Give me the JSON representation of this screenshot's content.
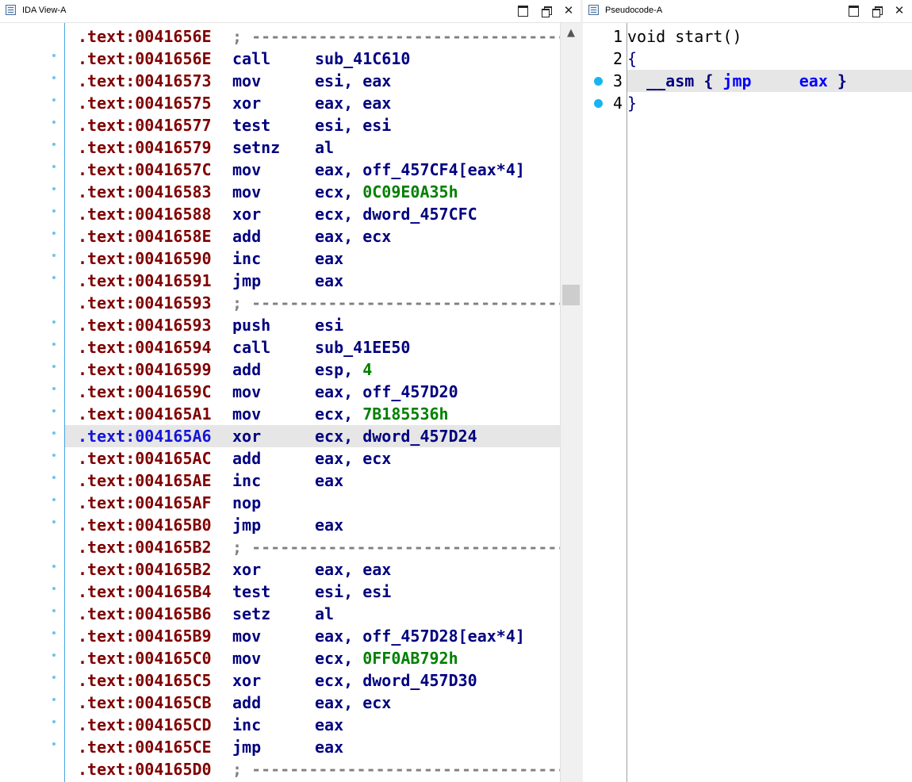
{
  "ida_window": {
    "title": "IDA View-A"
  },
  "pseudo_window": {
    "title": "Pseudocode-A"
  },
  "window_controls": {
    "maximize": "☐",
    "restore": "⧉",
    "close": "✕"
  },
  "ida_listing": [
    {
      "addr": ".text:0041656E",
      "type": "sep",
      "text": "; ---------------------------------------------------------------------------",
      "dot": false
    },
    {
      "addr": ".text:0041656E",
      "mnem": "call",
      "ops": [
        {
          "t": "sub_41C610",
          "k": "n"
        }
      ],
      "dot": true
    },
    {
      "addr": ".text:00416573",
      "mnem": "mov",
      "ops": [
        {
          "t": "esi, eax",
          "k": "n"
        }
      ],
      "dot": true
    },
    {
      "addr": ".text:00416575",
      "mnem": "xor",
      "ops": [
        {
          "t": "eax, eax",
          "k": "n"
        }
      ],
      "dot": true
    },
    {
      "addr": ".text:00416577",
      "mnem": "test",
      "ops": [
        {
          "t": "esi, esi",
          "k": "n"
        }
      ],
      "dot": true
    },
    {
      "addr": ".text:00416579",
      "mnem": "setnz",
      "ops": [
        {
          "t": "al",
          "k": "n"
        }
      ],
      "dot": true
    },
    {
      "addr": ".text:0041657C",
      "mnem": "mov",
      "ops": [
        {
          "t": "eax, off_457CF4[eax*4]",
          "k": "n"
        }
      ],
      "dot": true
    },
    {
      "addr": ".text:00416583",
      "mnem": "mov",
      "ops": [
        {
          "t": "ecx, ",
          "k": "n"
        },
        {
          "t": "0C09E0A35h",
          "k": "num"
        }
      ],
      "dot": true
    },
    {
      "addr": ".text:00416588",
      "mnem": "xor",
      "ops": [
        {
          "t": "ecx, dword_457CFC",
          "k": "n"
        }
      ],
      "dot": true
    },
    {
      "addr": ".text:0041658E",
      "mnem": "add",
      "ops": [
        {
          "t": "eax, ecx",
          "k": "n"
        }
      ],
      "dot": true
    },
    {
      "addr": ".text:00416590",
      "mnem": "inc",
      "ops": [
        {
          "t": "eax",
          "k": "n"
        }
      ],
      "dot": true
    },
    {
      "addr": ".text:00416591",
      "mnem": "jmp",
      "ops": [
        {
          "t": "eax",
          "k": "n"
        }
      ],
      "dot": true
    },
    {
      "addr": ".text:00416593",
      "type": "sep",
      "text": "; ---------------------------------------------------------------------------",
      "dot": false
    },
    {
      "addr": ".text:00416593",
      "mnem": "push",
      "ops": [
        {
          "t": "esi",
          "k": "n"
        }
      ],
      "dot": true
    },
    {
      "addr": ".text:00416594",
      "mnem": "call",
      "ops": [
        {
          "t": "sub_41EE50",
          "k": "n"
        }
      ],
      "dot": true
    },
    {
      "addr": ".text:00416599",
      "mnem": "add",
      "ops": [
        {
          "t": "esp, ",
          "k": "n"
        },
        {
          "t": "4",
          "k": "num"
        }
      ],
      "dot": true
    },
    {
      "addr": ".text:0041659C",
      "mnem": "mov",
      "ops": [
        {
          "t": "eax, off_457D20",
          "k": "n"
        }
      ],
      "dot": true
    },
    {
      "addr": ".text:004165A1",
      "mnem": "mov",
      "ops": [
        {
          "t": "ecx, ",
          "k": "n"
        },
        {
          "t": "7B185536h",
          "k": "num"
        }
      ],
      "dot": true
    },
    {
      "addr": ".text:004165A6",
      "mnem": "xor",
      "ops": [
        {
          "t": "ecx, dword_457D24",
          "k": "n"
        }
      ],
      "dot": true,
      "highlight": true
    },
    {
      "addr": ".text:004165AC",
      "mnem": "add",
      "ops": [
        {
          "t": "eax, ecx",
          "k": "n"
        }
      ],
      "dot": true
    },
    {
      "addr": ".text:004165AE",
      "mnem": "inc",
      "ops": [
        {
          "t": "eax",
          "k": "n"
        }
      ],
      "dot": true
    },
    {
      "addr": ".text:004165AF",
      "mnem": "nop",
      "ops": [],
      "dot": true
    },
    {
      "addr": ".text:004165B0",
      "mnem": "jmp",
      "ops": [
        {
          "t": "eax",
          "k": "n"
        }
      ],
      "dot": true
    },
    {
      "addr": ".text:004165B2",
      "type": "sep",
      "text": "; ---------------------------------------------------------------------------",
      "dot": false
    },
    {
      "addr": ".text:004165B2",
      "mnem": "xor",
      "ops": [
        {
          "t": "eax, eax",
          "k": "n"
        }
      ],
      "dot": true
    },
    {
      "addr": ".text:004165B4",
      "mnem": "test",
      "ops": [
        {
          "t": "esi, esi",
          "k": "n"
        }
      ],
      "dot": true
    },
    {
      "addr": ".text:004165B6",
      "mnem": "setz",
      "ops": [
        {
          "t": "al",
          "k": "n"
        }
      ],
      "dot": true
    },
    {
      "addr": ".text:004165B9",
      "mnem": "mov",
      "ops": [
        {
          "t": "eax, off_457D28[eax*4]",
          "k": "n"
        }
      ],
      "dot": true
    },
    {
      "addr": ".text:004165C0",
      "mnem": "mov",
      "ops": [
        {
          "t": "ecx, ",
          "k": "n"
        },
        {
          "t": "0FF0AB792h",
          "k": "num"
        }
      ],
      "dot": true
    },
    {
      "addr": ".text:004165C5",
      "mnem": "xor",
      "ops": [
        {
          "t": "ecx, dword_457D30",
          "k": "n"
        }
      ],
      "dot": true
    },
    {
      "addr": ".text:004165CB",
      "mnem": "add",
      "ops": [
        {
          "t": "eax, ecx",
          "k": "n"
        }
      ],
      "dot": true
    },
    {
      "addr": ".text:004165CD",
      "mnem": "inc",
      "ops": [
        {
          "t": "eax",
          "k": "n"
        }
      ],
      "dot": true
    },
    {
      "addr": ".text:004165CE",
      "mnem": "jmp",
      "ops": [
        {
          "t": "eax",
          "k": "n"
        }
      ],
      "dot": true
    },
    {
      "addr": ".text:004165D0",
      "type": "sep",
      "text": "; ---------------------------------------------------------------------------",
      "dot": false
    }
  ],
  "pseudocode": [
    {
      "num": "1",
      "dot": false,
      "tokens": [
        {
          "t": "void start()",
          "k": "plain"
        }
      ]
    },
    {
      "num": "2",
      "dot": false,
      "tokens": [
        {
          "t": "{",
          "k": "kw"
        }
      ]
    },
    {
      "num": "3",
      "dot": true,
      "highlight": true,
      "tokens": [
        {
          "t": "  __asm { ",
          "k": "asm"
        },
        {
          "t": "jmp",
          "k": "jmp"
        },
        {
          "t": "     ",
          "k": "asm"
        },
        {
          "t": "eax",
          "k": "jmp"
        },
        {
          "t": " }",
          "k": "asm"
        }
      ]
    },
    {
      "num": "4",
      "dot": true,
      "tokens": [
        {
          "t": "}",
          "k": "kw"
        }
      ]
    }
  ],
  "colors": {
    "address": "#800000",
    "mnemonic": "#000080",
    "number": "#008000",
    "highlight": "#e6e6e6",
    "breakpoint_dot": "#18b4f0"
  }
}
